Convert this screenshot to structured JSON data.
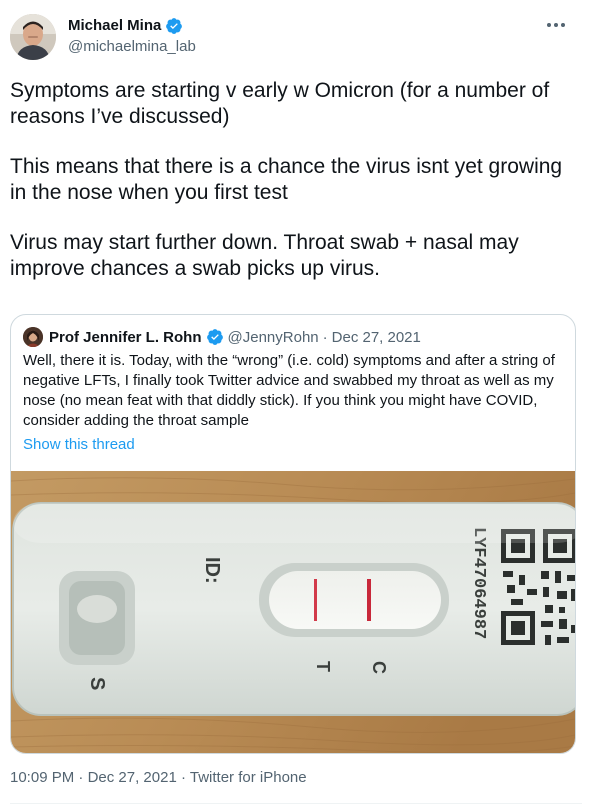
{
  "author": {
    "name": "Michael Mina",
    "handle": "@michaelmina_lab"
  },
  "tweet": {
    "paragraphs": [
      "Symptoms are starting v early w Omicron (for a number of reasons I’ve discussed)",
      "This means that there is a chance the virus isnt yet growing in the nose when you first test",
      "Virus may start further down. Throat swab + nasal may improve chances a swab picks up virus."
    ]
  },
  "quote": {
    "name": "Prof Jennifer L. Rohn",
    "handle": "@JennyRohn",
    "separator": "·",
    "date": "Dec 27, 2021",
    "text": "Well, there it is. Today, with the “wrong” (i.e. cold) symptoms and after a string of negative LFTs, I finally took Twitter advice and swabbed my throat as well as my nose (no mean feat with that diddly stick). If you think you might have COVID, consider adding the throat sample",
    "show_thread": "Show this thread",
    "image": {
      "labels": {
        "id": "ID:",
        "c": "C",
        "t": "T",
        "s": "S",
        "serial": "LYF47064987"
      }
    }
  },
  "footer": {
    "time": "10:09 PM",
    "separator1": "·",
    "date": "Dec 27, 2021",
    "separator2": "·",
    "source": "Twitter for iPhone"
  },
  "colors": {
    "text": "#0f1419",
    "secondary": "#536471",
    "link": "#1d9bf0",
    "verified": "#1d9bf0",
    "border": "#cfd9de"
  }
}
